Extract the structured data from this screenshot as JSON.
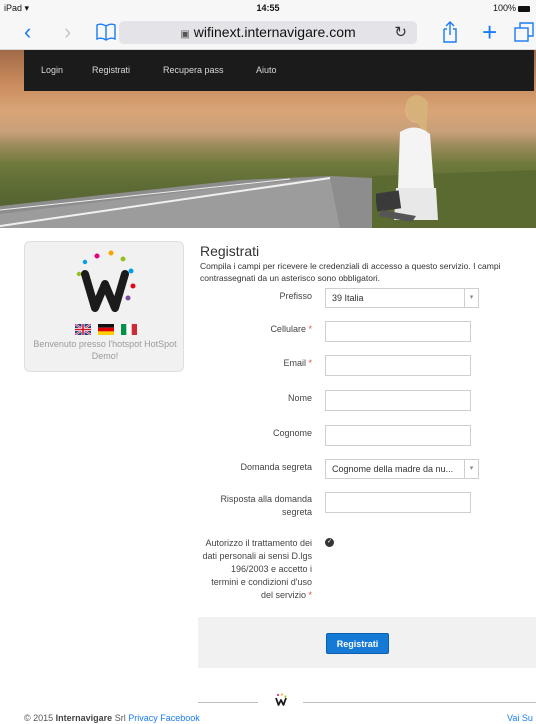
{
  "status_bar": {
    "device": "iPad",
    "wifi_glyph": "▾",
    "time": "14:55",
    "battery": "100%"
  },
  "browser": {
    "back_glyph": "‹",
    "forward_glyph": "›",
    "bookmarks_glyph": "≡",
    "lock_glyph": "▣",
    "url": "wifinext.internavigare.com",
    "reload_glyph": "↻",
    "share_glyph": "↑",
    "new_tab_glyph": "+",
    "tabs_glyph": "❐"
  },
  "nav": {
    "items": [
      "Login",
      "Registrati",
      "Recupera pass",
      "Aiuto"
    ]
  },
  "sidebar": {
    "welcome": "Benvenuto presso l'hotspot HotSpot Demo!"
  },
  "form": {
    "title": "Registrati",
    "description": "Compila i campi per ricevere le credenziali di accesso a questo servizio. I campi contrassegnati da un asterisco sono obbligatori.",
    "required_mark": "*",
    "prefisso_label": "Prefisso",
    "prefisso_value": "39 Italia",
    "cellulare_label": "Cellulare",
    "email_label": "Email",
    "nome_label": "Nome",
    "cognome_label": "Cognome",
    "domanda_label": "Domanda segreta",
    "domanda_value": "Cognome della madre da nu...",
    "risposta_label_1": "Risposta alla domanda",
    "risposta_label_2": "segreta",
    "privacy_line_1": "Autorizzo il trattamento dei",
    "privacy_line_2": "dati personali ai sensi D.lgs",
    "privacy_line_3": "196/2003 e accetto i",
    "privacy_line_4": "termini e condizioni d'uso",
    "privacy_line_5": "del servizio",
    "submit_label": "Registrati",
    "check_glyph": "✓",
    "select_arrow": "▾"
  },
  "footer": {
    "copyright_prefix": "© 2015 ",
    "company": "Internavigare",
    "company_suffix": " Srl ",
    "privacy_link": "Privacy",
    "facebook_link": "Facebook",
    "back_to_top": "Vai Su"
  },
  "colors": {
    "accent": "#1579d6",
    "nav_bg": "#1b1b1b",
    "required": "#d9534f"
  }
}
